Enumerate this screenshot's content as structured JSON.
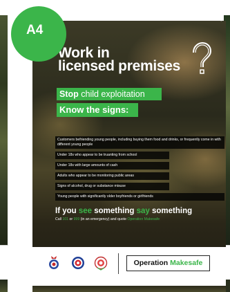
{
  "badge": {
    "label": "A4"
  },
  "poster": {
    "title_line1": "Work in",
    "title_line2": "licensed premises",
    "question_mark": "?",
    "stop_bold": "Stop",
    "stop_rest": " child exploitation",
    "know_signs": "Know the signs:",
    "signs": [
      "Customers befriending young people, including buying them food and drinks, or frequently come in with different young people",
      "Under 18s who appear to be truanting from school",
      "Under 18s with large amounts of cash",
      "Adults who appear to be monitoring public areas",
      "Signs of alcohol, drug or substance misuse",
      "Young people with significantly older boyfriends or girlfriends"
    ],
    "cta_if_you": "If you ",
    "cta_see": "see",
    "cta_something1": " something ",
    "cta_say": "say",
    "cta_something2": " something",
    "call_prefix": "Call ",
    "call_101": "101",
    "call_or": " or ",
    "call_999": "999",
    "call_mid": " (in an emergency) and quote ",
    "call_quote": "Operation Makesafe",
    "footer_operation": "Operation ",
    "footer_makesafe": "Makesafe"
  },
  "colors": {
    "green": "#3bb54a",
    "white": "#ffffff",
    "dark": "#111111"
  },
  "icons": [
    "police-crest-logo",
    "circular-badge-logo",
    "emblem-logo"
  ]
}
